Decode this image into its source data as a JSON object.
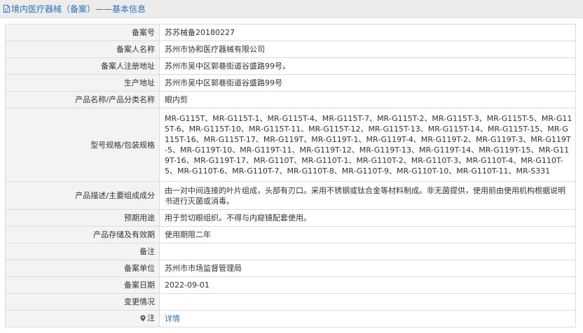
{
  "header": {
    "title": "境内医疗器械（备案）——基本信息"
  },
  "rows": [
    {
      "label": "备案号",
      "value": "苏苏械备20180227"
    },
    {
      "label": "备案人名称",
      "value": "苏州市协和医疗器械有限公司"
    },
    {
      "label": "备案人注册地址",
      "value": "苏州市吴中区郭巷街道谷盛路99号。"
    },
    {
      "label": "生产地址",
      "value": "苏州市吴中区郭巷街道谷盛路99号"
    },
    {
      "label": "产品名称/产品分类名称",
      "value": "眼内剪"
    },
    {
      "label": "型号规格/包装规格",
      "value": "MR-G115T、MR-G115T-1、MR-G115T-4、MR-G115T-7、MR-G115T-2、MR-G115T-3、MR-G115T-5、MR-G115T-6、MR-G115T-10、MR-G115T-11、MR-G115T-12、MR-G115T-13、MR-G115T-14、MR-G115T-15、MR-G115T-16、MR-G115T-17、MR-G119T、MR-G119T-1、MR-G119T-4、MR-G119T-2、MR-G119T-3、MR-G119T-5、MR-G119T-10、MR-G119T-11、MR-G119T-12、MR-G119T-13、MR-G119T-14、MR-G119T-15、MR-G119T-16、MR-G119T-17、MR-G110T、MR-G110T-1、MR-G110T-2、MR-G110T-3、MR-G110T-4、MR-G110T-5、MR-G110T-6、MR-G110T-7、MR-G110T-8、MR-G110T-9、MR-G110T-10、MR-G110T-11、MR-S331"
    },
    {
      "label": "产品描述/主要组成成分",
      "value": "由一对中间连接的叶片组成，头部有刃口。采用不锈钢或钛合金等材料制成。非无菌提供，使用前由使用机构根据说明书进行灭菌或消毒。"
    },
    {
      "label": "预期用途",
      "value": "用于剪切眼组织。不得与内窥镜配套使用。"
    },
    {
      "label": "产品存储及有效期",
      "value": "使用期限二年"
    },
    {
      "label": "备注",
      "value": ""
    },
    {
      "label": "备案单位",
      "value": "苏州市市场监督管理局"
    },
    {
      "label": "备案日期",
      "value": "2022-09-01"
    },
    {
      "label": "变更情况",
      "value": ""
    }
  ],
  "note": {
    "label": "注",
    "link_text": "详情"
  }
}
